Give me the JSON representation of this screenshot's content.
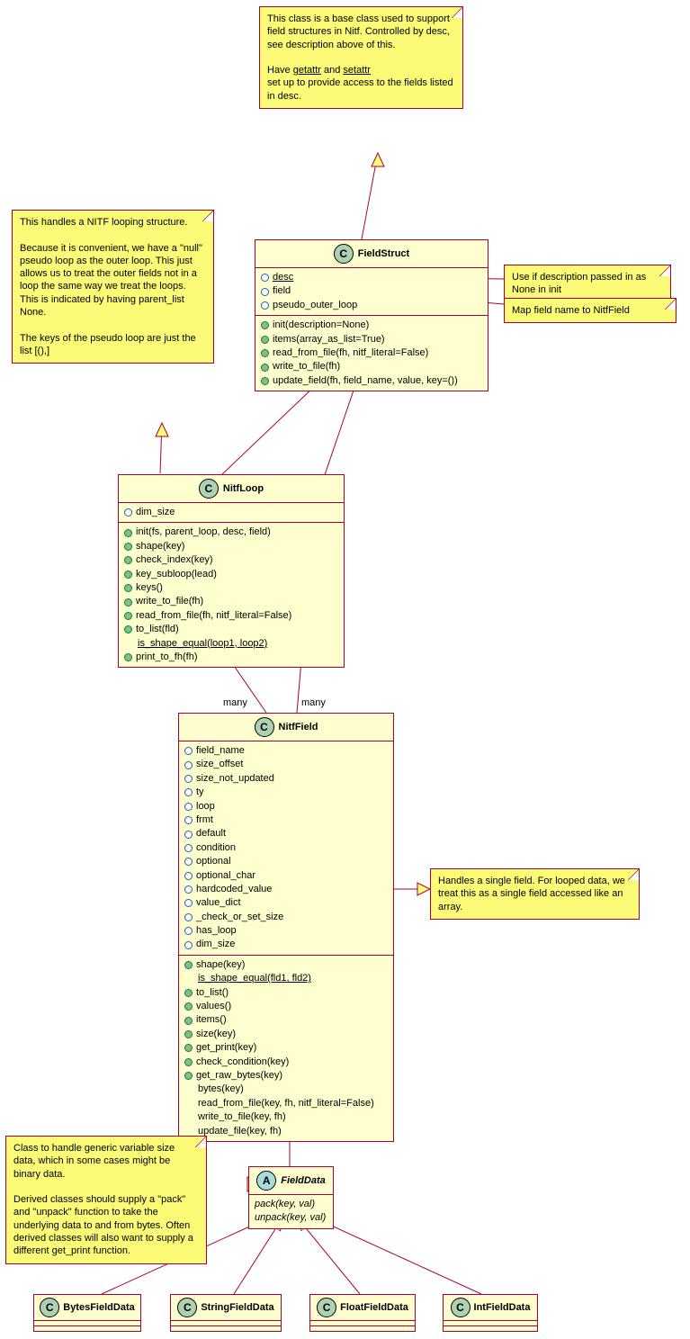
{
  "notes": {
    "fieldStruct": {
      "p1": "This class is a base class used to support field structures in Nitf. Controlled by desc, see description above of this.",
      "p2a": "Have ",
      "getattr": "getattr",
      "and": " and ",
      "setattr": "setattr",
      "p2b": " set up to provide access to the fields listed in desc."
    },
    "desc": "Use if description passed in as None in init",
    "field": "Map field name to NitfField",
    "nitfLoop": {
      "p1": "This handles a NITF looping structure.",
      "p2": "Because it is convenient, we have a \"null\" pseudo loop as the outer loop.  This just allows us to treat the outer fields not in a loop the same way we treat the loops.  This is indicated by having parent_list None.",
      "p3": "The keys of the pseudo loop are just the list [(),]"
    },
    "nitfField": "Handles a single field. For looped data, we treat this as a single field accessed like an array.",
    "fieldData": {
      "p1": "Class to handle generic variable size data, which in some cases might be binary data.",
      "p2": "Derived classes should supply a \"pack\" and \"unpack\" function to take the underlying data to and from bytes.  Often derived classes will also want to supply a different get_print function."
    }
  },
  "classes": {
    "FieldStruct": {
      "name": "FieldStruct",
      "attrs": [
        "desc",
        "field",
        "pseudo_outer_loop"
      ],
      "methods": [
        "init(description=None)",
        "items(array_as_list=True)",
        "read_from_file(fh, nitf_literal=False)",
        "write_to_file(fh)",
        "update_field(fh, field_name, value, key=())"
      ]
    },
    "NitfLoop": {
      "name": "NitfLoop",
      "attrs": [
        "dim_size"
      ],
      "methods": [
        "init(fs, parent_loop, desc, field)",
        "shape(key)",
        "check_index(key)",
        "key_subloop(lead)",
        "keys()",
        "write_to_file(fh)",
        "read_from_file(fh, nitf_literal=False)",
        "to_list(fld)"
      ],
      "static": "is_shape_equal(loop1, loop2)",
      "methods2": [
        "print_to_fh(fh)"
      ]
    },
    "NitfField": {
      "name": "NitfField",
      "attrs": [
        "field_name",
        "size_offset",
        "size_not_updated",
        "ty",
        "loop",
        "frmt",
        "default",
        "condition",
        "optional",
        "optional_char",
        "hardcoded_value",
        "value_dict",
        "_check_or_set_size",
        "has_loop",
        "dim_size"
      ],
      "methods1": [
        "shape(key)"
      ],
      "static": "is_shape_equal(fld1, fld2)",
      "methods2": [
        "to_list()",
        "values()",
        "items()",
        "size(key)",
        "get_print(key)",
        "check_condition(key)",
        "get_raw_bytes(key)"
      ],
      "plain": [
        "bytes(key)",
        "read_from_file(key, fh, nitf_literal=False)",
        "write_to_file(key, fh)",
        "update_file(key, fh)"
      ]
    },
    "FieldData": {
      "name": "FieldData",
      "methods": [
        "pack(key, val)",
        "unpack(key, val)"
      ]
    },
    "leaves": [
      "BytesFieldData",
      "StringFieldData",
      "FloatFieldData",
      "IntFieldData"
    ]
  },
  "labels": {
    "many1": "many",
    "many2": "many"
  }
}
